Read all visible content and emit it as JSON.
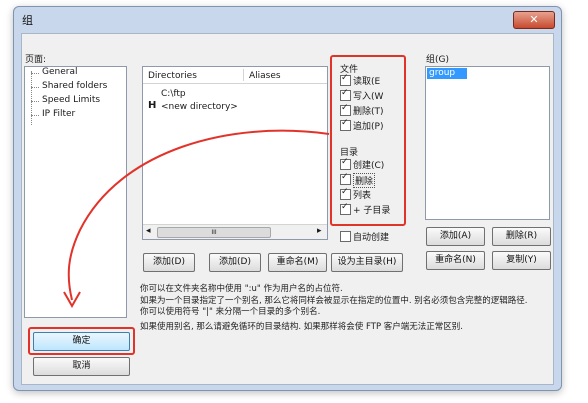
{
  "window": {
    "title": "组",
    "close_glyph": "✕"
  },
  "pages": {
    "label": "页面:",
    "items": [
      "General",
      "Shared folders",
      "Speed Limits",
      "IP Filter"
    ]
  },
  "dirs": {
    "col_directories": "Directories",
    "col_aliases": "Aliases",
    "rows": [
      "C:\\ftp"
    ],
    "new_marker": "H",
    "new_label": "<new directory>",
    "scroll_left": "◂",
    "scroll_right": "▸",
    "scroll_grip": "III"
  },
  "files_perm": {
    "title": "文件",
    "items": [
      {
        "label": "读取(E",
        "checked": true
      },
      {
        "label": "写入(W",
        "checked": true
      },
      {
        "label": "删除(T)",
        "checked": true
      },
      {
        "label": "追加(P)",
        "checked": true
      }
    ]
  },
  "dir_perm": {
    "title": "目录",
    "items": [
      {
        "label": "创建(C)",
        "checked": true
      },
      {
        "label": "删除",
        "checked": true
      },
      {
        "label": "列表",
        "checked": true
      },
      {
        "label": "+ 子目录",
        "checked": true
      }
    ]
  },
  "autocreate": {
    "label": "自动创建",
    "checked": false
  },
  "dir_buttons": {
    "add": "添加(D)",
    "remove": "添加(D)",
    "rename": "重命名(M)",
    "set_home": "设为主目录(H)"
  },
  "groups": {
    "label": "组(G)",
    "items": [
      "group"
    ],
    "add": "添加(A)",
    "remove": "删除(R)",
    "rename": "重命名(N)",
    "copy": "复制(Y)"
  },
  "description": {
    "line1": "你可以在文件夹名称中使用 \":u\" 作为用户名的占位符.",
    "line2": "如果为一个目录指定了一个别名, 那么它将同样会被显示在指定的位置中. 别名必须包含完整的逻辑路径. 你可以使用符号 \"|\" 来分隔一个目录的多个别名.",
    "line3": "如果使用别名, 那么请避免循环的目录结构. 如果那样将会使 FTP 客户端无法正常区别."
  },
  "ok": "确定",
  "cancel": "取消",
  "colors": {
    "annotation": "#e2332a",
    "selection": "#3399ff"
  }
}
